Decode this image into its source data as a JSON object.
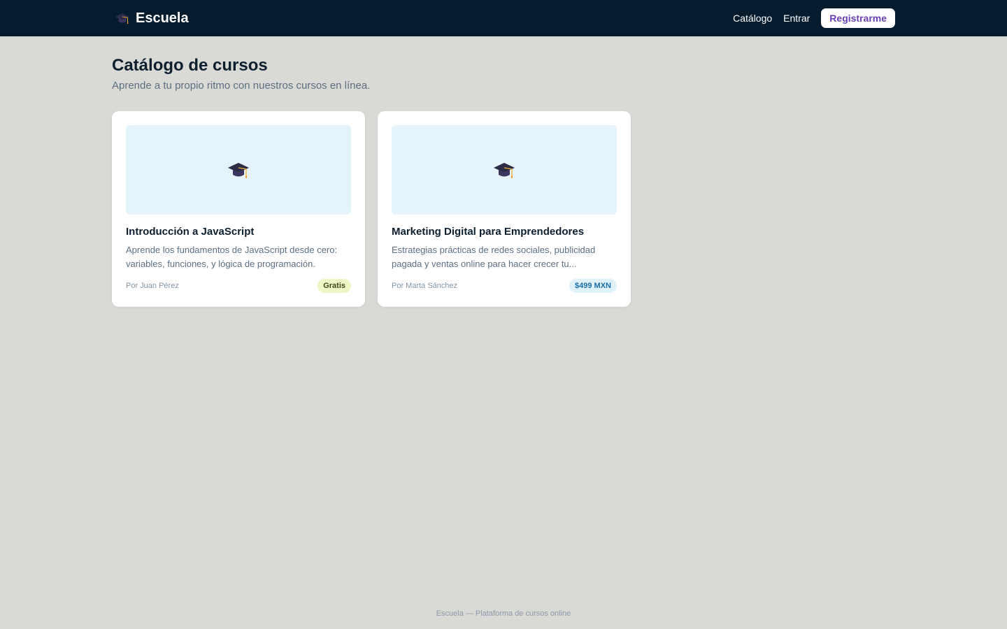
{
  "navbar": {
    "brand_icon": "graduation-cap-icon",
    "brand": "Escuela",
    "links": [
      "Catálogo",
      "Entrar"
    ],
    "cta": "Registrarme"
  },
  "page": {
    "title": "Catálogo de cursos",
    "subtitle": "Aprende a tu propio ritmo con nuestros cursos en línea."
  },
  "courses": [
    {
      "icon": "graduation-cap-icon",
      "title": "Introducción a JavaScript",
      "description": "Aprende los fundamentos de JavaScript desde cero: variables, funciones, y lógica de programación.",
      "author": "Por Juan Pérez",
      "price": "Gratis"
    },
    {
      "icon": "graduation-cap-icon",
      "title": "Marketing Digital para Emprendedores",
      "description": "Estrategias prácticas de redes sociales, publicidad pagada y ventas online para hacer crecer tu...",
      "author": "Por Marta Sánchez",
      "price": "$499 MXN"
    }
  ],
  "footer": "Escuela — Plataforma de cursos online",
  "colors": {
    "navbar_bg": "#041c2e",
    "page_bg": "#d9d9d5",
    "cta_text": "#6a3fb3",
    "thumb_bg": "#e5f3fb",
    "badge_free_bg": "#edf6c4",
    "badge_price_bg": "#dff1fb"
  }
}
